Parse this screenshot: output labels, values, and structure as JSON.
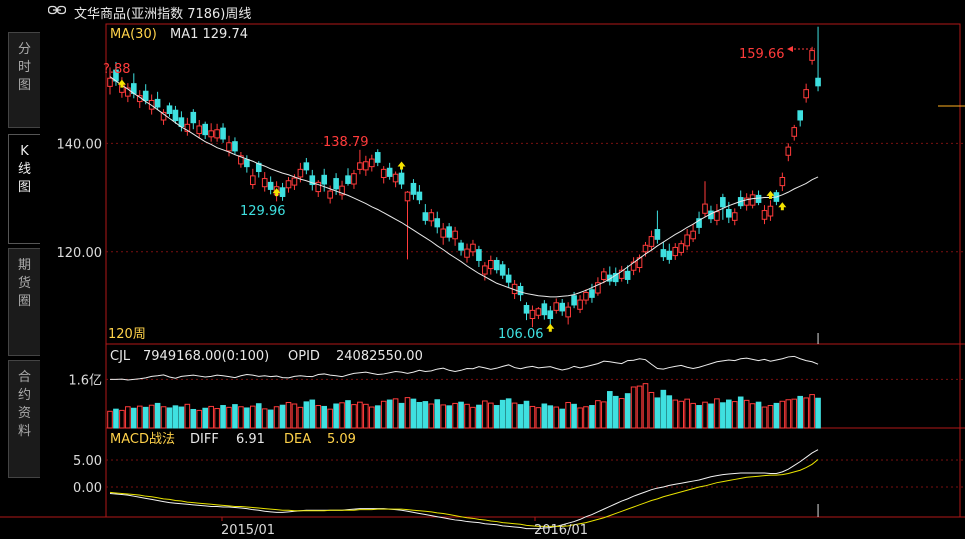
{
  "header": {
    "title": "文华商品(亚洲指数 7186)周线",
    "link_icon": "link-icon"
  },
  "side_tabs": [
    {
      "label": [
        "分",
        "时",
        "图"
      ],
      "active": false
    },
    {
      "label": [
        "K",
        "线",
        "图"
      ],
      "active": true
    },
    {
      "label": [
        "期",
        "货",
        "圈"
      ],
      "active": false
    },
    {
      "label": [
        "合",
        "约",
        "资",
        "料"
      ],
      "active": false
    }
  ],
  "colors": {
    "up": "#ff3b3b",
    "down": "#3fe0e0",
    "ma": "#e8e8e8",
    "label_yellow": "#ffd24a",
    "axis": "#b01818",
    "grid": "#7a1010",
    "arrow_up": "#f5e300",
    "hline": "#ffb020"
  },
  "price_panel": {
    "legend_ma": "MA(30)",
    "legend_ma1": "MA1 129.74",
    "period": "120周",
    "y_ticks": [
      "140.00",
      "120.00"
    ],
    "y_tick_values": [
      140,
      120
    ],
    "annotations": {
      "left": "?.88",
      "high1": "138.79",
      "low1": "129.96",
      "low2": "106.06",
      "high2": "159.66"
    }
  },
  "volume_panel": {
    "label_cjl": "CJL",
    "cjl_value": "7949168.00(0:100)",
    "label_opid": "OPID",
    "opid_value": "24082550.00",
    "y_tick": "1.6亿"
  },
  "macd_panel": {
    "label": "MACD战法",
    "diff_label": "DIFF",
    "diff_value": "6.91",
    "dea_label": "DEA",
    "dea_value": "5.09",
    "y_ticks": [
      "5.00",
      "0.00"
    ],
    "y_tick_values": [
      5,
      0
    ]
  },
  "x_axis": {
    "ticks": [
      "2015/01",
      "2016/01"
    ]
  },
  "chart_data": {
    "type": "candlestick",
    "title": "文华商品(亚洲指数 7186)周线",
    "ylim": [
      103,
      162
    ],
    "close": [
      152.0,
      151.5,
      151.0,
      150.2,
      149.2,
      148.8,
      147.9,
      147.9,
      146.7,
      145.7,
      145.5,
      144.2,
      143.1,
      143.5,
      143.8,
      143.2,
      141.6,
      142.3,
      142.5,
      140.8,
      140.1,
      138.6,
      137.7,
      135.7,
      134.0,
      134.8,
      133.5,
      131.5,
      132.0,
      130.2,
      133.1,
      133.6,
      135.2,
      135.1,
      132.4,
      132.8,
      132.5,
      131.2,
      131.6,
      132.1,
      132.6,
      134.4,
      136.4,
      136.6,
      137.1,
      136.5,
      135.2,
      133.9,
      134.3,
      132.5,
      131.0,
      130.6,
      129.6,
      125.8,
      127.2,
      124.6,
      124.2,
      122.7,
      123.8,
      120.3,
      120.5,
      121.4,
      118.4,
      117.4,
      118.4,
      116.7,
      115.7,
      114.4,
      114.0,
      112.1,
      108.7,
      109.2,
      109.5,
      108.4,
      107.7,
      110.6,
      109.1,
      109.8,
      110.2,
      111.1,
      112.5,
      111.6,
      114.3,
      116.3,
      114.6,
      114.5,
      116.6,
      114.9,
      118.1,
      118.9,
      121.2,
      122.8,
      122.3,
      119.1,
      118.6,
      120.8,
      121.5,
      123.1,
      123.8,
      124.5,
      128.8,
      126.1,
      127.4,
      128.3,
      126.4,
      127.2,
      128.5,
      129.9,
      130.5,
      129.1,
      127.6,
      128.4,
      129.3,
      133.7,
      139.3,
      142.9,
      144.3,
      149.9,
      157.1,
      150.6
    ],
    "ohlc_note": "open/high/low shown in series below",
    "open": [
      150.5,
      153.5,
      149.4,
      148.7,
      151.0,
      147.7,
      149.6,
      146.3,
      148.1,
      144.3,
      146.9,
      146.1,
      144.7,
      142.2,
      145.7,
      141.8,
      143.5,
      141.2,
      141.0,
      142.8,
      138.6,
      140.3,
      136.2,
      137.0,
      132.4,
      136.3,
      132.0,
      132.8,
      130.5,
      131.8,
      131.8,
      132.3,
      133.8,
      136.4,
      134.0,
      131.1,
      134.1,
      129.9,
      133.5,
      130.5,
      134.0,
      132.5,
      135.2,
      135.1,
      135.7,
      138.3,
      133.7,
      135.4,
      132.9,
      134.5,
      129.4,
      132.6,
      131.0,
      127.2,
      125.7,
      126.1,
      122.7,
      124.6,
      122.4,
      121.6,
      119.0,
      120.0,
      120.4,
      115.9,
      116.9,
      118.4,
      117.6,
      115.7,
      112.3,
      113.6,
      110.1,
      107.7,
      108.3,
      110.4,
      109.1,
      109.2,
      110.5,
      108.0,
      111.9,
      109.4,
      111.1,
      113.0,
      112.4,
      114.9,
      115.7,
      116.0,
      115.1,
      116.4,
      116.6,
      117.1,
      120.0,
      121.0,
      124.1,
      120.4,
      120.1,
      119.3,
      119.9,
      121.1,
      122.4,
      126.1,
      127.1,
      127.5,
      125.8,
      130.0,
      127.8,
      125.8,
      130.0,
      128.6,
      128.6,
      130.4,
      126.0,
      126.6,
      130.9,
      132.2,
      137.8,
      141.3,
      146.0,
      148.4,
      155.3,
      152.0
    ],
    "high": [
      154.0,
      155.0,
      152.2,
      151.1,
      152.9,
      149.8,
      150.9,
      149.0,
      149.5,
      146.3,
      147.5,
      146.9,
      145.9,
      144.7,
      146.3,
      144.3,
      144.0,
      143.7,
      143.6,
      143.7,
      141.4,
      141.1,
      138.4,
      137.8,
      135.3,
      136.7,
      134.7,
      133.9,
      133.0,
      132.7,
      133.8,
      134.3,
      136.4,
      137.3,
      135.1,
      133.2,
      135.3,
      132.2,
      134.5,
      133.1,
      135.4,
      135.1,
      138.8,
      137.7,
      137.9,
      138.9,
      135.8,
      136.4,
      134.8,
      135.5,
      131.2,
      133.4,
      132.3,
      128.8,
      127.9,
      127.4,
      125.3,
      125.3,
      124.6,
      122.2,
      121.5,
      122.2,
      121.1,
      118.1,
      119.3,
      119.0,
      118.3,
      117.0,
      114.8,
      114.3,
      110.7,
      110.1,
      109.8,
      111.1,
      110.0,
      111.4,
      111.3,
      110.7,
      112.6,
      112.0,
      113.1,
      114.1,
      115.3,
      117.0,
      117.3,
      117.1,
      117.4,
      117.5,
      119.0,
      119.5,
      121.8,
      123.9,
      127.6,
      121.8,
      121.5,
      121.6,
      122.1,
      124.2,
      125.1,
      127.4,
      133.0,
      128.5,
      128.8,
      130.7,
      129.2,
      128.0,
      131.3,
      130.8,
      131.3,
      131.3,
      128.6,
      129.5,
      131.4,
      134.6,
      140.0,
      143.4,
      144.9,
      151.0,
      157.8,
      161.5
    ],
    "low": [
      149.0,
      150.6,
      148.4,
      147.6,
      148.3,
      146.5,
      147.2,
      145.3,
      146.2,
      143.4,
      144.9,
      143.6,
      142.2,
      141.4,
      142.6,
      140.9,
      140.8,
      140.3,
      140.3,
      140.1,
      137.6,
      137.9,
      135.5,
      134.6,
      131.6,
      133.7,
      131.1,
      130.6,
      129.3,
      129.4,
      130.9,
      131.4,
      132.8,
      134.3,
      131.3,
      130.1,
      131.1,
      128.9,
      130.5,
      129.6,
      132.2,
      131.6,
      134.3,
      134.0,
      134.8,
      135.8,
      132.6,
      133.3,
      131.9,
      131.6,
      118.6,
      129.6,
      128.8,
      125.0,
      124.7,
      123.4,
      121.3,
      121.9,
      121.1,
      119.3,
      118.0,
      119.2,
      117.2,
      114.7,
      115.8,
      116.0,
      115.0,
      113.5,
      111.3,
      110.9,
      107.4,
      106.1,
      107.6,
      107.5,
      106.6,
      108.6,
      108.2,
      106.6,
      109.6,
      108.7,
      110.3,
      110.6,
      111.9,
      114.2,
      113.8,
      113.7,
      114.5,
      114.1,
      115.7,
      116.2,
      119.1,
      120.3,
      121.5,
      118.3,
      117.8,
      118.5,
      119.3,
      120.3,
      121.8,
      123.3,
      126.4,
      125.3,
      124.9,
      125.9,
      125.3,
      124.9,
      127.9,
      127.6,
      128.0,
      128.6,
      125.1,
      125.7,
      128.6,
      131.2,
      136.7,
      140.5,
      143.1,
      147.5,
      154.5,
      149.6
    ],
    "ma30": [
      152.3,
      151.5,
      150.7,
      150.0,
      149.2,
      148.5,
      147.7,
      147.0,
      146.2,
      145.4,
      144.6,
      143.8,
      143.0,
      142.4,
      141.7,
      141.0,
      140.3,
      139.8,
      139.2,
      138.8,
      138.4,
      137.9,
      137.5,
      137.1,
      136.7,
      136.2,
      135.8,
      135.3,
      134.9,
      134.5,
      134.2,
      133.8,
      133.4,
      133.1,
      132.7,
      132.4,
      132.0,
      131.6,
      131.2,
      130.8,
      130.4,
      129.9,
      129.4,
      128.9,
      128.3,
      127.8,
      127.2,
      126.6,
      126.0,
      125.4,
      124.7,
      124.0,
      123.3,
      122.6,
      121.9,
      121.1,
      120.4,
      119.6,
      118.9,
      118.2,
      117.4,
      116.7,
      116.0,
      115.4,
      114.8,
      114.2,
      113.8,
      113.4,
      113.0,
      112.6,
      112.3,
      112.1,
      111.9,
      111.8,
      111.7,
      111.7,
      111.8,
      111.9,
      112.1,
      112.5,
      112.9,
      113.4,
      113.9,
      114.4,
      115.0,
      115.7,
      116.4,
      117.2,
      118.0,
      118.8,
      119.6,
      120.3,
      121.1,
      121.8,
      122.5,
      123.2,
      123.8,
      124.5,
      125.1,
      125.8,
      126.4,
      127.0,
      127.5,
      128.0,
      128.5,
      128.9,
      129.3,
      129.6,
      129.8,
      129.9,
      130.0,
      130.0,
      130.1,
      130.5,
      131.0,
      131.6,
      132.1,
      132.6,
      133.3,
      133.8
    ],
    "series": [
      {
        "name": "CJL",
        "values": [
          0.55,
          0.62,
          0.58,
          0.7,
          0.65,
          0.72,
          0.68,
          0.75,
          0.81,
          0.7,
          0.66,
          0.73,
          0.69,
          0.78,
          0.61,
          0.58,
          0.65,
          0.71,
          0.64,
          0.74,
          0.68,
          0.77,
          0.7,
          0.66,
          0.72,
          0.8,
          0.63,
          0.59,
          0.7,
          0.75,
          0.84,
          0.79,
          0.68,
          0.86,
          0.92,
          0.74,
          0.71,
          0.62,
          0.79,
          0.83,
          0.9,
          0.77,
          0.85,
          0.78,
          0.69,
          0.73,
          0.88,
          0.92,
          0.96,
          0.81,
          1.0,
          0.95,
          0.84,
          0.87,
          0.79,
          0.93,
          0.76,
          0.73,
          0.81,
          0.85,
          0.78,
          0.68,
          0.75,
          0.89,
          0.82,
          0.74,
          0.91,
          0.96,
          0.82,
          0.77,
          0.88,
          0.71,
          0.67,
          0.79,
          0.73,
          0.69,
          0.62,
          0.84,
          0.78,
          0.66,
          0.7,
          0.74,
          0.9,
          0.86,
          1.2,
          1.04,
          0.97,
          1.13,
          1.35,
          1.38,
          1.46,
          1.17,
          0.99,
          1.24,
          1.06,
          0.92,
          0.88,
          0.95,
          0.81,
          0.74,
          0.85,
          0.79,
          0.96,
          0.83,
          0.92,
          0.87,
          1.02,
          0.91,
          0.8,
          0.85,
          0.69,
          0.74,
          0.81,
          0.88,
          0.93,
          0.95,
          1.04,
          0.99,
          1.1,
          0.98
        ]
      },
      {
        "name": "OPID",
        "values": [
          1.6,
          1.6,
          1.61,
          1.58,
          1.6,
          1.62,
          1.65,
          1.7,
          1.72,
          1.75,
          1.68,
          1.64,
          1.7,
          1.72,
          1.74,
          1.71,
          1.68,
          1.7,
          1.74,
          1.72,
          1.69,
          1.66,
          1.72,
          1.76,
          1.74,
          1.7,
          1.72,
          1.69,
          1.71,
          1.66,
          1.65,
          1.7,
          1.72,
          1.7,
          1.69,
          1.76,
          1.78,
          1.74,
          1.72,
          1.69,
          1.75,
          1.8,
          1.82,
          1.84,
          1.8,
          1.76,
          1.78,
          1.82,
          1.86,
          1.84,
          1.8,
          1.84,
          1.9,
          1.86,
          1.88,
          1.94,
          1.97,
          1.9,
          1.86,
          1.9,
          1.96,
          1.95,
          2.02,
          1.98,
          1.93,
          1.97,
          2.03,
          2.08,
          1.99,
          1.95,
          2.0,
          2.03,
          1.98,
          2.0,
          2.02,
          1.96,
          1.91,
          1.95,
          2.03,
          1.98,
          2.02,
          2.07,
          2.12,
          2.2,
          2.18,
          2.15,
          2.12,
          2.22,
          2.23,
          2.28,
          2.25,
          2.1,
          1.96,
          1.94,
          1.99,
          2.03,
          2.06,
          2.0,
          1.96,
          2.0,
          2.06,
          2.12,
          2.18,
          2.21,
          2.24,
          2.22,
          2.28,
          2.3,
          2.26,
          2.22,
          2.26,
          2.2,
          2.24,
          2.28,
          2.34,
          2.36,
          2.28,
          2.22,
          2.18,
          2.1
        ]
      },
      {
        "name": "DIFF",
        "values": [
          -1.2,
          -1.3,
          -1.4,
          -1.5,
          -1.7,
          -1.9,
          -2.1,
          -2.3,
          -2.5,
          -2.7,
          -2.9,
          -3.0,
          -3.1,
          -3.2,
          -3.3,
          -3.4,
          -3.5,
          -3.6,
          -3.6,
          -3.7,
          -3.7,
          -3.8,
          -3.9,
          -4.0,
          -4.2,
          -4.3,
          -4.5,
          -4.6,
          -4.7,
          -4.7,
          -4.6,
          -4.5,
          -4.4,
          -4.3,
          -4.3,
          -4.3,
          -4.3,
          -4.3,
          -4.3,
          -4.3,
          -4.2,
          -4.1,
          -4.0,
          -4.0,
          -4.0,
          -4.0,
          -4.0,
          -4.1,
          -4.2,
          -4.3,
          -4.5,
          -4.7,
          -4.9,
          -5.1,
          -5.3,
          -5.5,
          -5.7,
          -5.9,
          -6.1,
          -6.2,
          -6.4,
          -6.5,
          -6.6,
          -6.8,
          -6.9,
          -7.0,
          -7.2,
          -7.3,
          -7.4,
          -7.5,
          -7.7,
          -7.7,
          -7.7,
          -7.6,
          -7.5,
          -7.3,
          -7.0,
          -6.7,
          -6.4,
          -6.0,
          -5.5,
          -5.1,
          -4.6,
          -4.1,
          -3.6,
          -3.1,
          -2.6,
          -2.2,
          -1.7,
          -1.3,
          -0.9,
          -0.5,
          -0.2,
          0.0,
          0.3,
          0.5,
          0.7,
          0.9,
          1.1,
          1.3,
          1.6,
          1.9,
          2.1,
          2.3,
          2.4,
          2.5,
          2.6,
          2.6,
          2.6,
          2.6,
          2.6,
          2.5,
          2.5,
          2.8,
          3.3,
          4.0,
          4.7,
          5.5,
          6.3,
          6.91
        ]
      },
      {
        "name": "DEA",
        "values": [
          -1.0,
          -1.1,
          -1.2,
          -1.3,
          -1.4,
          -1.5,
          -1.7,
          -1.8,
          -2.0,
          -2.2,
          -2.3,
          -2.5,
          -2.6,
          -2.8,
          -2.9,
          -3.0,
          -3.1,
          -3.2,
          -3.3,
          -3.4,
          -3.5,
          -3.6,
          -3.6,
          -3.7,
          -3.8,
          -3.9,
          -4.0,
          -4.1,
          -4.2,
          -4.3,
          -4.3,
          -4.4,
          -4.4,
          -4.4,
          -4.4,
          -4.4,
          -4.4,
          -4.3,
          -4.3,
          -4.3,
          -4.3,
          -4.3,
          -4.2,
          -4.2,
          -4.2,
          -4.1,
          -4.1,
          -4.1,
          -4.1,
          -4.1,
          -4.2,
          -4.3,
          -4.4,
          -4.5,
          -4.6,
          -4.8,
          -4.9,
          -5.1,
          -5.3,
          -5.5,
          -5.7,
          -5.8,
          -6.0,
          -6.1,
          -6.3,
          -6.4,
          -6.6,
          -6.7,
          -6.8,
          -6.9,
          -7.1,
          -7.2,
          -7.3,
          -7.3,
          -7.3,
          -7.3,
          -7.3,
          -7.2,
          -7.0,
          -6.8,
          -6.6,
          -6.3,
          -6.0,
          -5.7,
          -5.3,
          -4.9,
          -4.5,
          -4.1,
          -3.7,
          -3.3,
          -2.9,
          -2.5,
          -2.2,
          -1.8,
          -1.5,
          -1.2,
          -0.9,
          -0.6,
          -0.3,
          0.0,
          0.2,
          0.5,
          0.8,
          1.0,
          1.2,
          1.4,
          1.6,
          1.8,
          1.9,
          2.0,
          2.1,
          2.2,
          2.2,
          2.3,
          2.5,
          2.8,
          3.1,
          3.6,
          4.2,
          5.09
        ]
      }
    ],
    "y_ticks_price": [
      140,
      120
    ],
    "y_ticks_macd": [
      5,
      0
    ],
    "xlabel": "",
    "ylabel": "",
    "x_ticks": [
      "2015/01",
      "2016/01"
    ],
    "grid": true
  }
}
